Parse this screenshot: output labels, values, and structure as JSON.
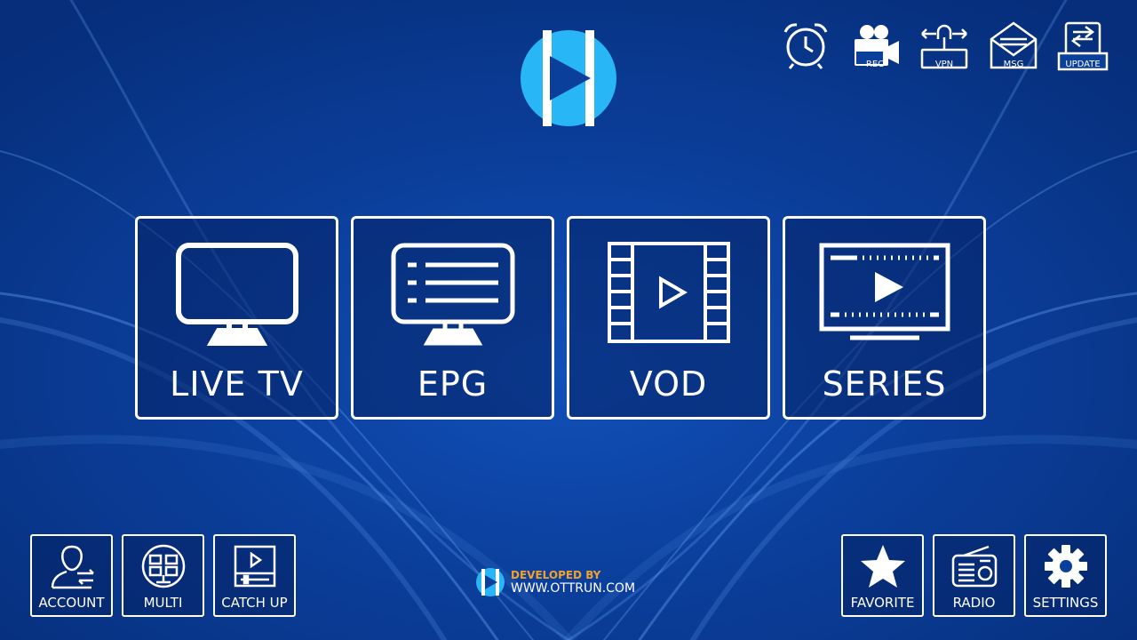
{
  "brand": {
    "logo_icon": "play-circle-logo-icon",
    "accent": "#29b6f6"
  },
  "top_bar": [
    {
      "name": "alarm-clock-button",
      "icon": "alarm-clock-icon",
      "label": ""
    },
    {
      "name": "rec-button",
      "icon": "camera-rec-icon",
      "label": "REC"
    },
    {
      "name": "vpn-button",
      "icon": "vpn-lock-icon",
      "label": "VPN"
    },
    {
      "name": "msg-button",
      "icon": "envelope-icon",
      "label": "MSG"
    },
    {
      "name": "update-button",
      "icon": "update-icon",
      "label": "UPDATE"
    }
  ],
  "main_tiles": [
    {
      "label": "LIVE TV",
      "icon": "tv-monitor-icon"
    },
    {
      "label": "EPG",
      "icon": "epg-list-icon"
    },
    {
      "label": "VOD",
      "icon": "film-strip-icon"
    },
    {
      "label": "SERIES",
      "icon": "series-play-icon"
    }
  ],
  "bottom_left": [
    {
      "label": "ACCOUNT",
      "icon": "account-user-icon"
    },
    {
      "label": "MULTI",
      "icon": "multi-screen-icon"
    },
    {
      "label": "CATCH UP",
      "icon": "catch-up-icon"
    }
  ],
  "bottom_right": [
    {
      "label": "FAVORITE",
      "icon": "star-icon"
    },
    {
      "label": "RADIO",
      "icon": "radio-icon"
    },
    {
      "label": "SETTINGS",
      "icon": "gear-icon"
    }
  ],
  "footer": {
    "developed_by": "DEVELOPED BY",
    "site": "WWW.OTTRUN.COM",
    "developed_color": "#f4a12c"
  }
}
